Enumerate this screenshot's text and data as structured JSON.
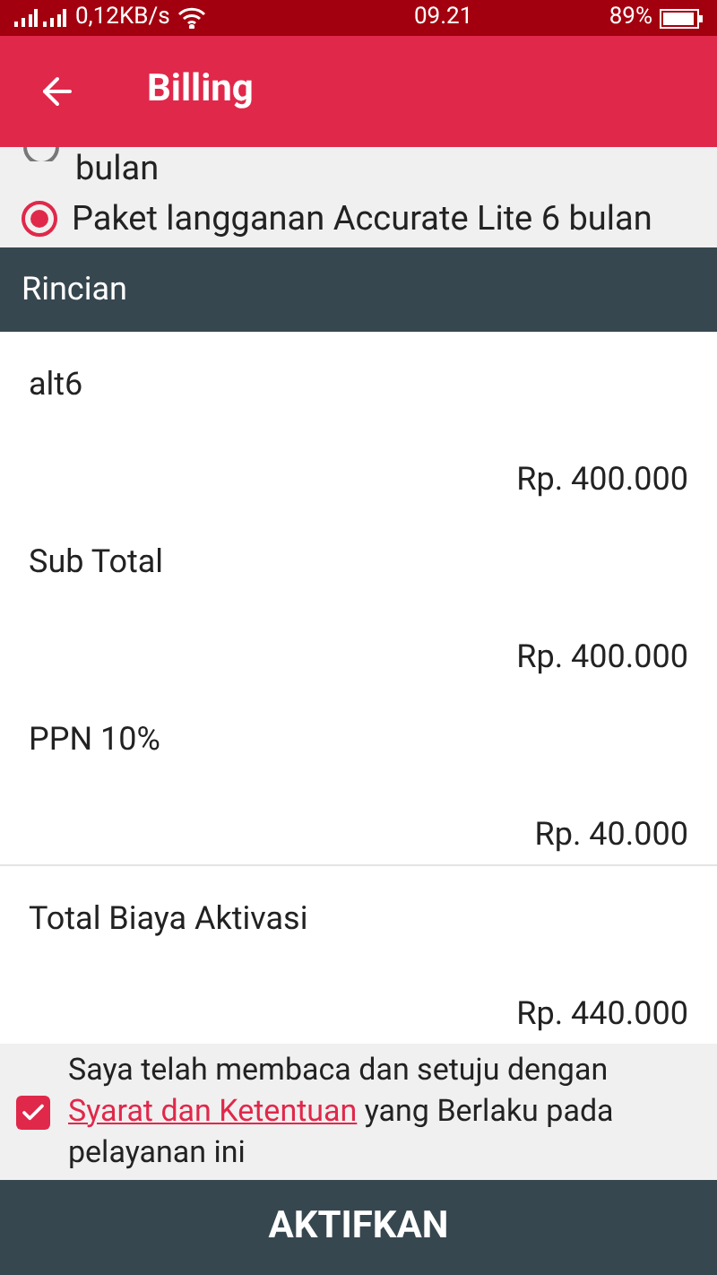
{
  "status_bar": {
    "speed": "0,12KB/s",
    "time": "09.21",
    "battery": "89%"
  },
  "app_bar": {
    "title": "Billing"
  },
  "options": [
    {
      "label": "bulan",
      "selected": false
    },
    {
      "label": "Paket langganan Accurate Lite 6 bulan",
      "selected": true
    }
  ],
  "section_title": "Rincian",
  "items": [
    {
      "name": "alt6",
      "amount": "Rp. 400.000"
    },
    {
      "name": "Sub Total",
      "amount": "Rp. 400.000"
    },
    {
      "name": "PPN 10%",
      "amount": "Rp. 40.000"
    },
    {
      "name": "Total Biaya Aktivasi",
      "amount": "Rp. 440.000"
    }
  ],
  "agreement": {
    "checked": true,
    "before": "Saya telah membaca dan setuju dengan",
    "link": "Syarat dan Ketentuan",
    "after": "yang Berlaku pada pelayanan ini"
  },
  "button": "AKTIFKAN"
}
